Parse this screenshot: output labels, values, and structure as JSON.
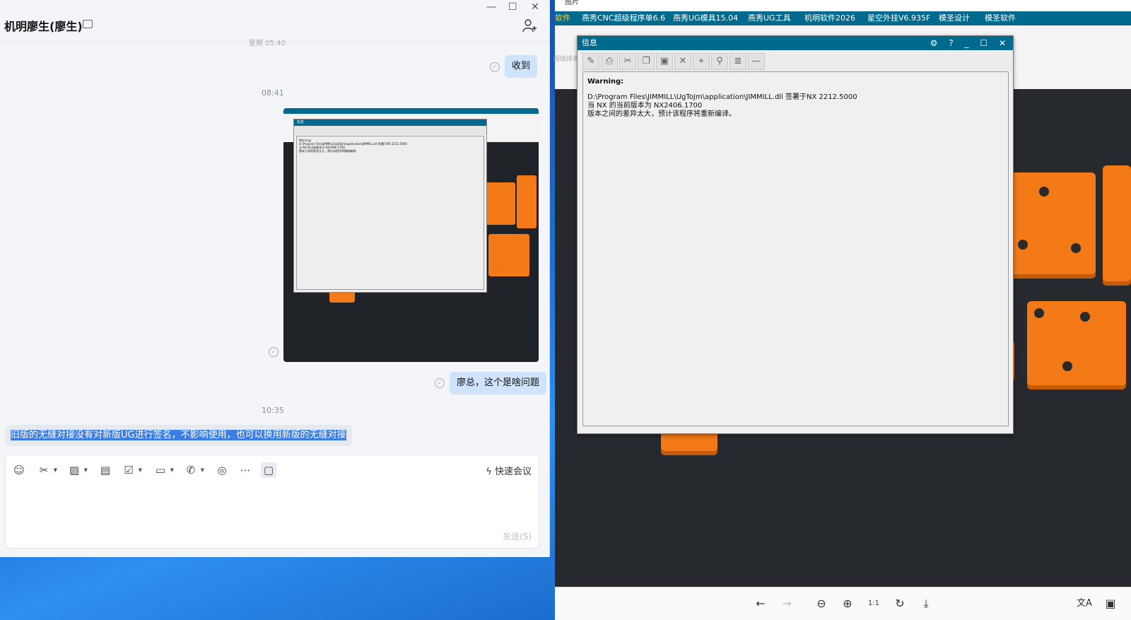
{
  "chat": {
    "contact_name": "机明廖生(廖生)",
    "cut_off_text": "星期 05:40",
    "window_controls": [
      "—",
      "☐",
      "✕"
    ],
    "messages": {
      "msg1_text": "收到",
      "ts1": "08:41",
      "msg2_text": "廖总，这个是啥问题",
      "ts2": "10:35",
      "msg3_text": "旧版的无缝对接没有对新版UG进行签名，不影响使用，也可以换用新版的无缝对接"
    },
    "composer": {
      "quick_meeting_label": "快速会议",
      "send_label": "发送(S)",
      "tools": [
        "emoji-icon",
        "scissors-icon",
        "image-icon",
        "document-icon",
        "task-icon",
        "folder-icon",
        "phone-icon",
        "copilot-icon",
        "more-icon",
        "chat-history-icon"
      ]
    }
  },
  "viewer": {
    "title": "图片",
    "menu": [
      "软件",
      "燕秀CNC超级程序单6.6",
      "燕秀UG模具15.04",
      "燕秀UG工具",
      "机明软件2026",
      "星空外挂V6.935F",
      "模圣设计",
      "模圣软件"
    ],
    "ribbon_item": "超级排条",
    "bottom_tools": [
      "back-icon",
      "forward-icon",
      "zoom-out-icon",
      "zoom-in-icon",
      "actual-size-icon",
      "rotate-icon",
      "download-icon",
      "translate-icon",
      "ocr-icon"
    ]
  },
  "dialog": {
    "title": "信息",
    "title_controls": "⚙ ? _ ☐ ✕",
    "warning_label": "Warning:",
    "line1": "D:\\Program Files\\JIMMILL\\UgToJm\\application\\JIMMILL.dll 签署于NX 2212.5000",
    "line2": "当 NX 的当前版本为 NX2406.1700",
    "line3": "版本之间的差异太大，预计该程序将重新编译。"
  }
}
